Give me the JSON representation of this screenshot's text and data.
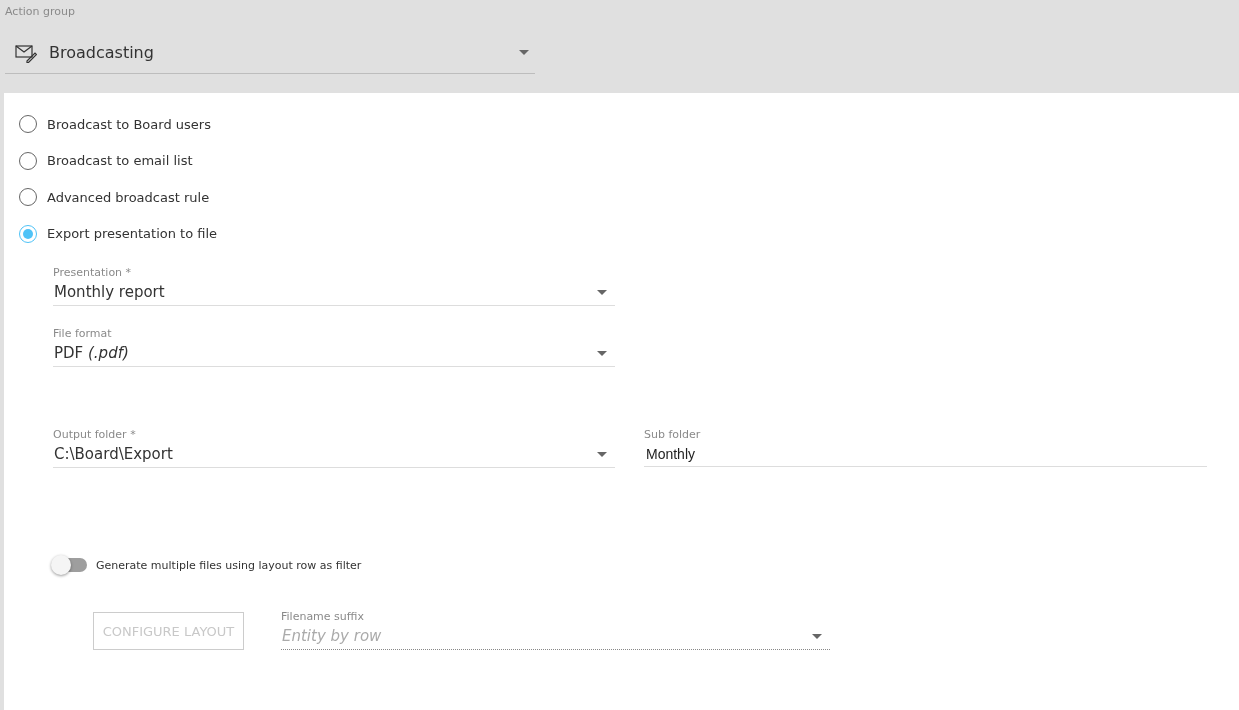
{
  "action_group": {
    "label": "Action group",
    "value": "Broadcasting"
  },
  "options": [
    {
      "label": "Broadcast to Board users",
      "selected": false
    },
    {
      "label": "Broadcast to email list",
      "selected": false
    },
    {
      "label": "Advanced broadcast rule",
      "selected": false
    },
    {
      "label": "Export presentation to file",
      "selected": true
    }
  ],
  "presentation": {
    "label": "Presentation *",
    "value": "Monthly report"
  },
  "file_format": {
    "label": "File format",
    "value": "PDF *(.pdf)*"
  },
  "output_folder": {
    "label": "Output folder *",
    "value": "C:\\Board\\Export"
  },
  "sub_folder": {
    "label": "Sub folder",
    "value": "Monthly"
  },
  "multiple_files": {
    "label": "Generate multiple files using layout row as filter",
    "on": false
  },
  "configure_layout": {
    "label": "CONFIGURE LAYOUT",
    "disabled": true
  },
  "filename_suffix": {
    "label": "Filename suffix",
    "placeholder": "Entity by row",
    "disabled": true
  }
}
